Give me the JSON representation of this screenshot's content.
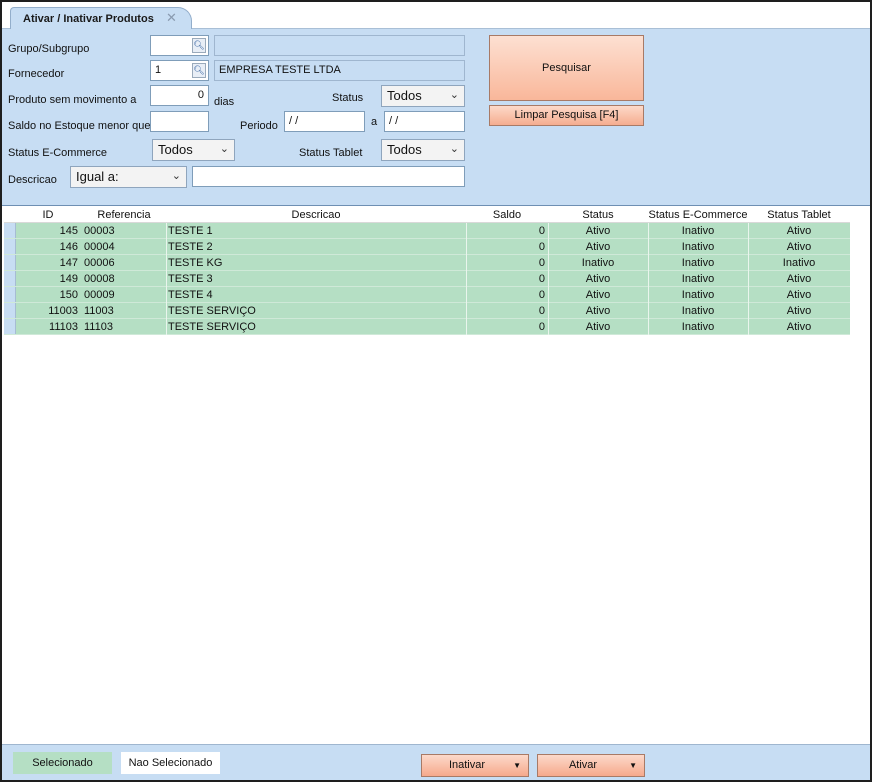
{
  "tab": {
    "title": "Ativar / Inativar Produtos",
    "close": "✕"
  },
  "filters": {
    "grupo_label": "Grupo/Subgrupo",
    "grupo_value": "",
    "grupo_desc": "",
    "fornecedor_label": "Fornecedor",
    "fornecedor_value": "1",
    "fornecedor_desc": "EMPRESA TESTE LTDA",
    "sem_mov_label": "Produto sem movimento a",
    "sem_mov_value": "0",
    "dias_label": "dias",
    "status_label": "Status",
    "status_value": "Todos",
    "saldo_label": "Saldo no Estoque menor que",
    "saldo_value": "",
    "periodo_label": "Periodo",
    "periodo_from": " / /",
    "periodo_a": "a",
    "periodo_to": " / /",
    "ecommerce_label": "Status E-Commerce",
    "ecommerce_value": "Todos",
    "tablet_label": "Status Tablet",
    "tablet_value": "Todos",
    "descricao_label": "Descricao",
    "descricao_mode": "Igual a:",
    "descricao_value": ""
  },
  "buttons": {
    "pesquisar": "Pesquisar",
    "limpar": "Limpar Pesquisa [F4]",
    "inativar": "Inativar",
    "ativar": "Ativar"
  },
  "grid": {
    "columns": [
      "ID",
      "Referencia",
      "Descricao",
      "Saldo",
      "Status",
      "Status E-Commerce",
      "Status Tablet"
    ],
    "rows": [
      {
        "id": "145",
        "ref": "00003",
        "desc": "TESTE 1",
        "saldo": "0",
        "status": "Ativo",
        "ecom": "Inativo",
        "tablet": "Ativo"
      },
      {
        "id": "146",
        "ref": "00004",
        "desc": "TESTE 2",
        "saldo": "0",
        "status": "Ativo",
        "ecom": "Inativo",
        "tablet": "Ativo"
      },
      {
        "id": "147",
        "ref": "00006",
        "desc": "TESTE KG",
        "saldo": "0",
        "status": "Inativo",
        "ecom": "Inativo",
        "tablet": "Inativo"
      },
      {
        "id": "149",
        "ref": "00008",
        "desc": "TESTE 3",
        "saldo": "0",
        "status": "Ativo",
        "ecom": "Inativo",
        "tablet": "Ativo"
      },
      {
        "id": "150",
        "ref": "00009",
        "desc": "TESTE 4",
        "saldo": "0",
        "status": "Ativo",
        "ecom": "Inativo",
        "tablet": "Ativo"
      },
      {
        "id": "11003",
        "ref": "11003",
        "desc": "TESTE SERVIÇO",
        "saldo": "0",
        "status": "Ativo",
        "ecom": "Inativo",
        "tablet": "Ativo"
      },
      {
        "id": "11103",
        "ref": "11103",
        "desc": "TESTE SERVIÇO",
        "saldo": "0",
        "status": "Ativo",
        "ecom": "Inativo",
        "tablet": "Ativo"
      }
    ]
  },
  "legend": {
    "selected": "Selecionado",
    "not_selected": "Nao Selecionado"
  },
  "colors": {
    "panel": "#c7ddf3",
    "selected_row": "#b5dfc4",
    "action_button": "#f9b79a"
  },
  "icons": {
    "lookup": "magnifier-icon",
    "dropdown": "chevron-down-icon"
  }
}
